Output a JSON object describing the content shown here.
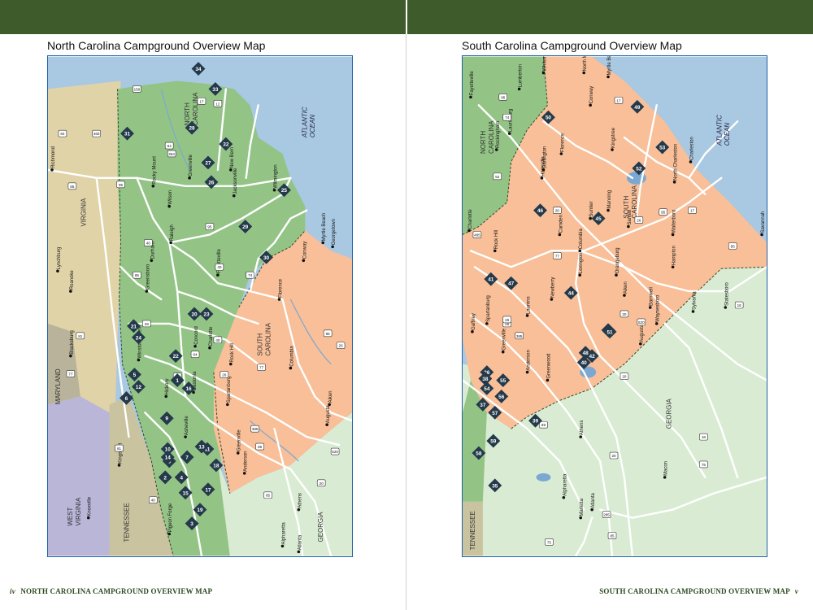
{
  "left_page": {
    "title": "North Carolina Campground Overview Map",
    "folio_number": "iv",
    "folio_text": "NORTH CAROLINA CAMPGROUND OVERVIEW MAP",
    "regions": {
      "virginia": "VIRGINIA",
      "north_carolina": [
        "NORTH",
        "CAROLINA"
      ],
      "south_carolina": [
        "SOUTH",
        "CAROLINA"
      ],
      "tennessee": "TENNESSEE",
      "west_virginia": [
        "WEST",
        "VIRGINIA"
      ],
      "maryland": "MARYLAND",
      "georgia": "GEORGIA",
      "ocean": [
        "ATLANTIC",
        "OCEAN"
      ]
    },
    "cities": [
      "Richmond",
      "Lynchburg",
      "Roanoke",
      "Blacksburg",
      "Raleigh",
      "Durham",
      "Rocky Mount",
      "Wilson",
      "Greenville",
      "New Bern",
      "Jacksonville",
      "Wilmington",
      "Fayetteville",
      "Greensboro",
      "Winston-Salem",
      "Charlotte",
      "Concord",
      "Rock Hill",
      "Hickory",
      "Gastonia",
      "Asheville",
      "Kingsport",
      "Knoxville",
      "Pigeon Forge",
      "Spartanburg",
      "Greenville",
      "Anderson",
      "Columbia",
      "Florence",
      "Conway",
      "Myrtle Beach",
      "Georgetown",
      "Aiken",
      "Augusta",
      "Athens",
      "Alpharetta",
      "Atlanta"
    ],
    "highways": [
      "64",
      "158",
      "17",
      "12",
      "460",
      "64",
      "264",
      "95",
      "85",
      "40",
      "81",
      "77",
      "95",
      "40",
      "85",
      "74",
      "26",
      "40",
      "26",
      "77",
      "385",
      "85",
      "20",
      "520",
      "95",
      "26",
      "81",
      "64",
      "40",
      "85",
      "1"
    ],
    "campgrounds": [
      "1",
      "2",
      "3",
      "4",
      "5",
      "6",
      "7",
      "8",
      "9",
      "10",
      "11",
      "12",
      "13",
      "14",
      "15",
      "16",
      "17",
      "18",
      "19",
      "20",
      "21",
      "22",
      "23",
      "24",
      "25",
      "26",
      "27",
      "28",
      "29",
      "30",
      "31",
      "32",
      "33",
      "34"
    ]
  },
  "right_page": {
    "title": "South Carolina Campground Overview Map",
    "folio_number": "v",
    "folio_text": "SOUTH CAROLINA CAMPGROUND OVERVIEW MAP",
    "regions": {
      "north_carolina": [
        "NORTH",
        "CAROLINA"
      ],
      "south_carolina": [
        "SOUTH",
        "CAROLINA"
      ],
      "georgia": "GEORGIA",
      "tennessee": "TENNESSEE",
      "ocean": [
        "ATLANTIC",
        "OCEAN"
      ]
    },
    "cities": [
      "Fayetteville",
      "Lumberton",
      "Whiteville",
      "North Myrtle Beach",
      "Myrtle Beach",
      "Conway",
      "Laurinburg",
      "Rockingham",
      "Darlington",
      "Florence",
      "Hartsville",
      "Kingstree",
      "Charleston",
      "North Charleston",
      "Charlotte",
      "Rock Hill",
      "Camden",
      "Sumter",
      "Manning",
      "Santee",
      "Walterboro",
      "Hampton",
      "Savannah",
      "Columbia",
      "Lexington",
      "Orangeburg",
      "Newberry",
      "Laurens",
      "Gaffney",
      "Spartanburg",
      "Greenwood",
      "Greenville",
      "Anderson",
      "Aiken",
      "Barnwell",
      "Augusta",
      "Waynesboro",
      "Sylvania",
      "Statesboro",
      "Athens",
      "Alpharetta",
      "Marietta",
      "Atlanta",
      "Macon"
    ],
    "highways": [
      "95",
      "74",
      "52",
      "17",
      "95",
      "20",
      "26",
      "77",
      "485",
      "26",
      "385",
      "26",
      "20",
      "520",
      "95",
      "16",
      "85",
      "20",
      "16",
      "75",
      "20",
      "285",
      "75",
      "85",
      "17"
    ],
    "campgrounds": [
      "35",
      "36",
      "37",
      "38",
      "39",
      "40",
      "41",
      "42",
      "43",
      "44",
      "45",
      "46",
      "47",
      "48",
      "49",
      "50",
      "51",
      "52",
      "53",
      "54",
      "55",
      "56",
      "57",
      "58",
      "59"
    ]
  }
}
